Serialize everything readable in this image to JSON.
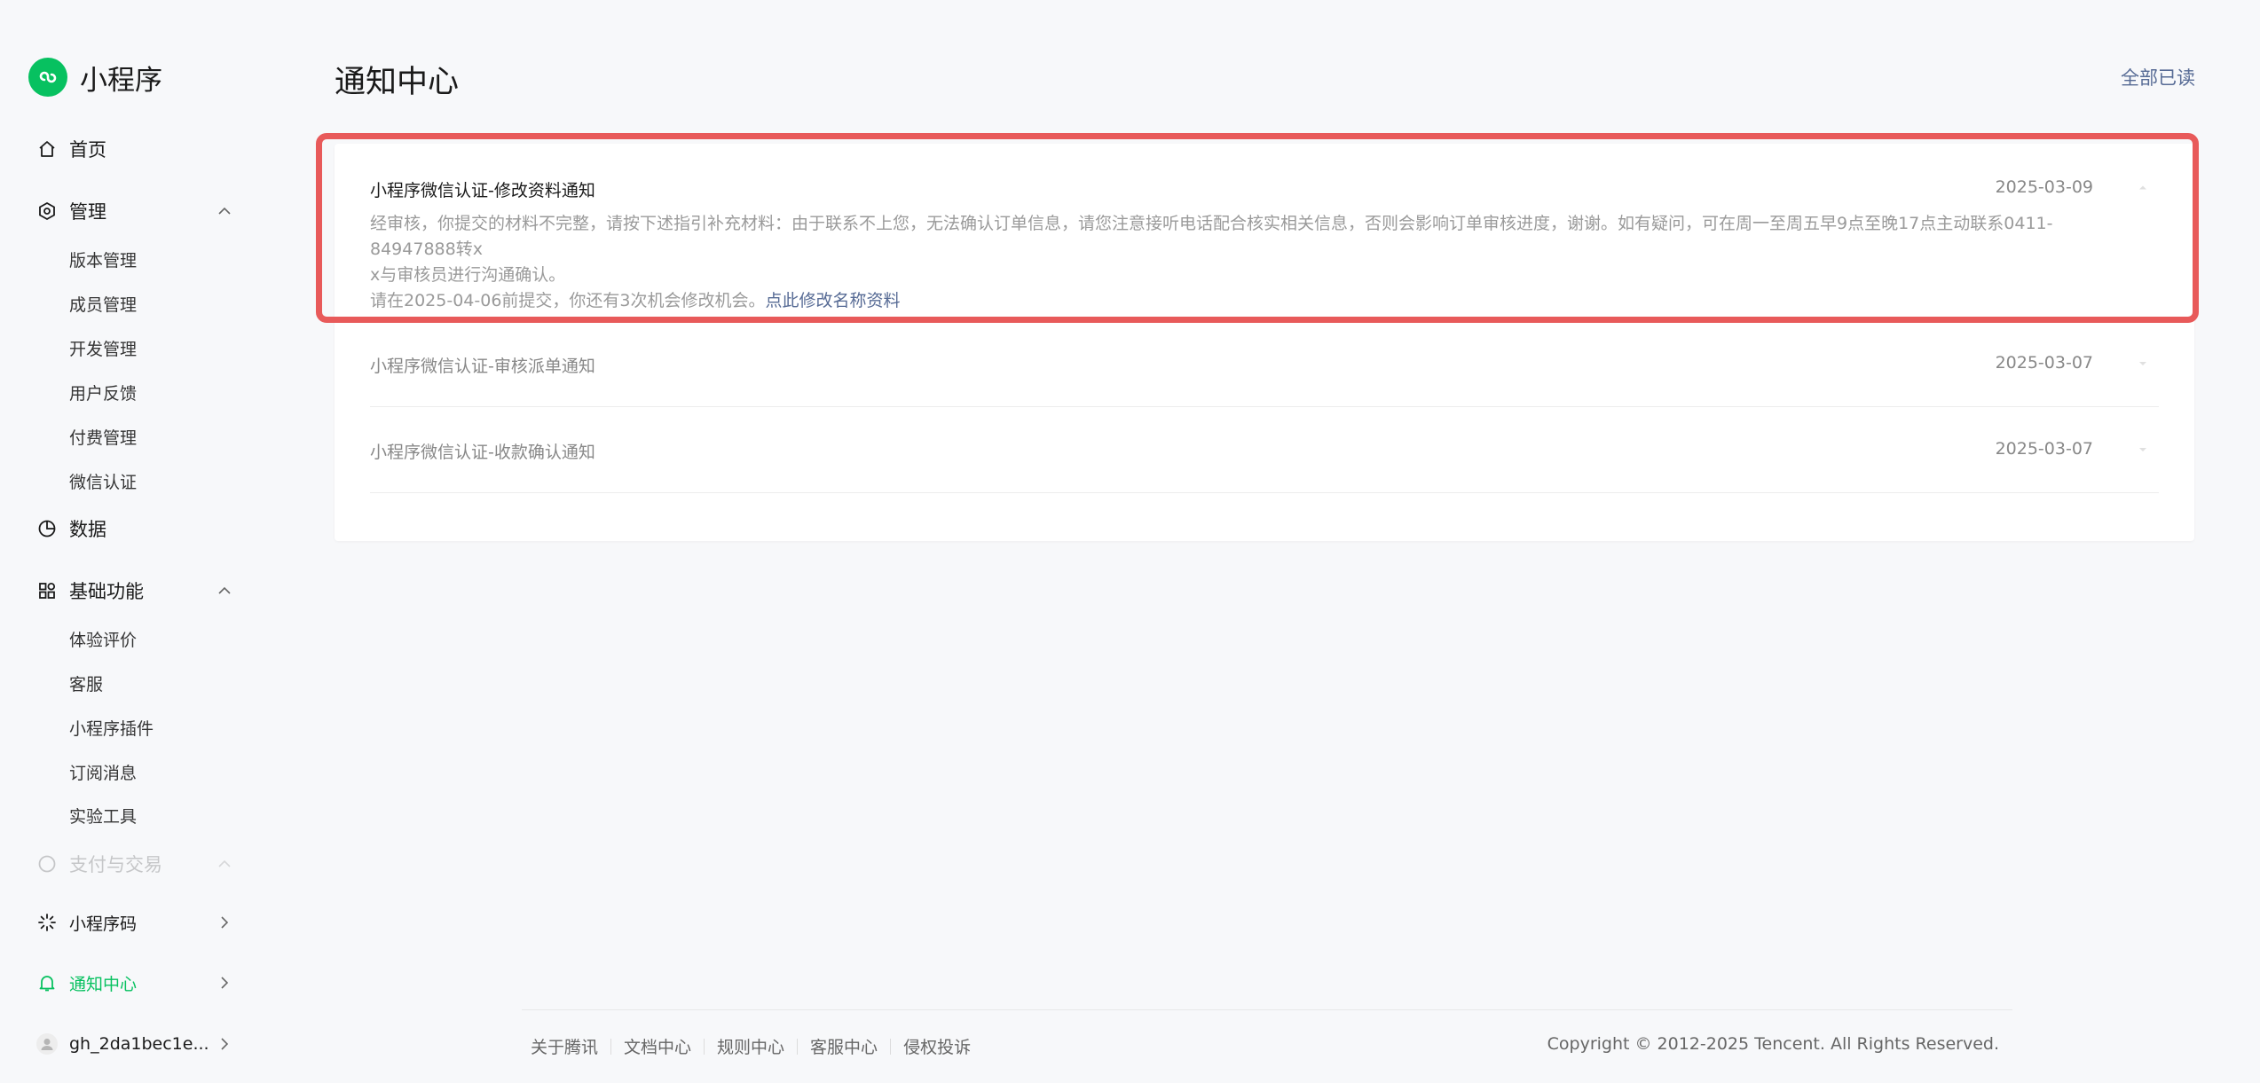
{
  "app": {
    "name": "小程序"
  },
  "sidebar": {
    "home": "首页",
    "manage": {
      "label": "管理",
      "items": [
        "版本管理",
        "成员管理",
        "开发管理",
        "用户反馈",
        "付费管理",
        "微信认证"
      ]
    },
    "data": "数据",
    "basic": {
      "label": "基础功能",
      "items": [
        "体验评价",
        "客服",
        "小程序插件",
        "订阅消息",
        "实验工具"
      ]
    },
    "payment": "支付与交易",
    "qrcode": "小程序码",
    "notice_center": "通知中心",
    "account": "gh_2da1bec1e..."
  },
  "main": {
    "title": "通知中心",
    "mark_all_read": "全部已读",
    "notices": [
      {
        "title": "小程序微信认证-修改资料通知",
        "date": "2025-03-09",
        "body_line1": "经审核，你提交的材料不完整，请按下述指引补充材料：由于联系不上您，无法确认订单信息，请您注意接听电话配合核实相关信息，否则会影响订单审核进度，谢谢。如有疑问，可在周一至周五早9点至晚17点主动联系0411-84947888转x",
        "body_line2": "x与审核员进行沟通确认。",
        "body_line3": "请在2025-04-06前提交，你还有3次机会修改机会。",
        "link": "点此修改名称资料"
      },
      {
        "title": "小程序微信认证-审核派单通知",
        "date": "2025-03-07"
      },
      {
        "title": "小程序微信认证-收款确认通知",
        "date": "2025-03-07"
      }
    ]
  },
  "footer": {
    "links": [
      "关于腾讯",
      "文档中心",
      "规则中心",
      "客服中心",
      "侵权投诉"
    ],
    "copyright": "Copyright © 2012-2025 Tencent. All Rights Reserved."
  },
  "colors": {
    "brand": "#07c160",
    "link": "#576b95",
    "highlight": "#e85a5a"
  }
}
